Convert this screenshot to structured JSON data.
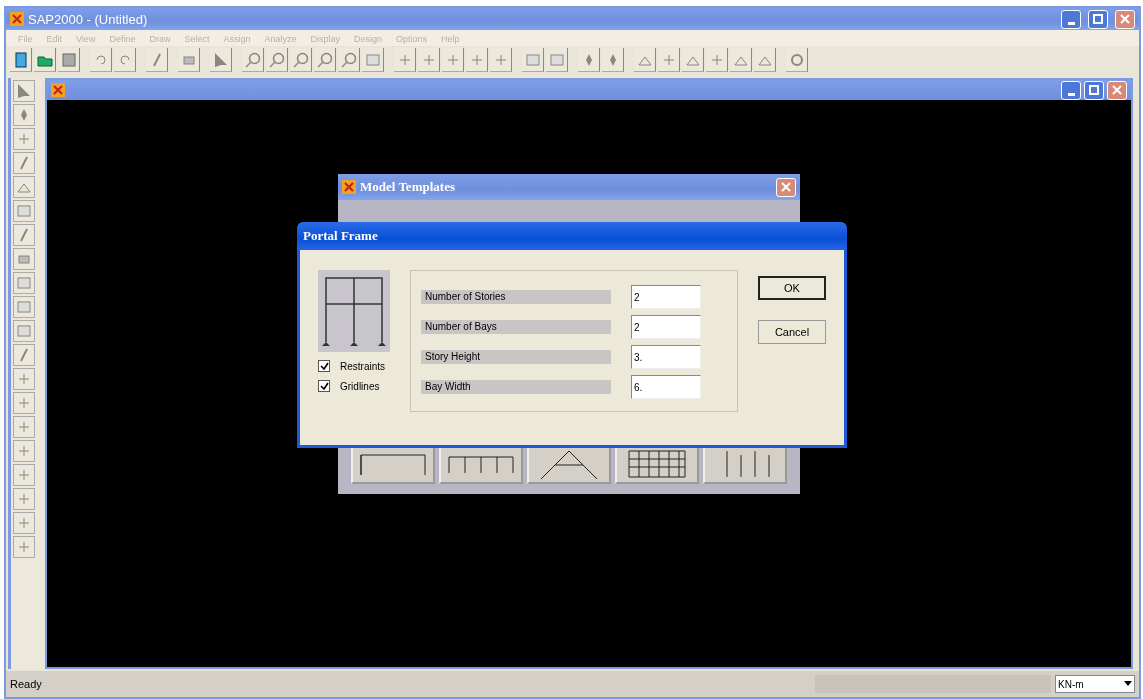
{
  "window": {
    "title": "SAP2000 - (Untitled)"
  },
  "menu": [
    "File",
    "Edit",
    "View",
    "Define",
    "Draw",
    "Select",
    "Assign",
    "Analyze",
    "Display",
    "Design",
    "Options",
    "Help"
  ],
  "model_templates": {
    "title": "Model Templates"
  },
  "portal_frame": {
    "title": "Portal Frame",
    "options": [
      {
        "label": "Restraints",
        "checked": true
      },
      {
        "label": "Gridlines",
        "checked": true
      }
    ],
    "fields": [
      {
        "label": "Number of Stories",
        "value": "2"
      },
      {
        "label": "Number of Bays",
        "value": "2"
      },
      {
        "label": "Story Height",
        "value": "3."
      },
      {
        "label": "Bay Width",
        "value": "6."
      }
    ],
    "buttons": [
      {
        "label": "OK",
        "default": true
      },
      {
        "label": "Cancel",
        "default": false
      }
    ]
  },
  "status_bar": {
    "text": "Ready",
    "units": "KN-m"
  }
}
